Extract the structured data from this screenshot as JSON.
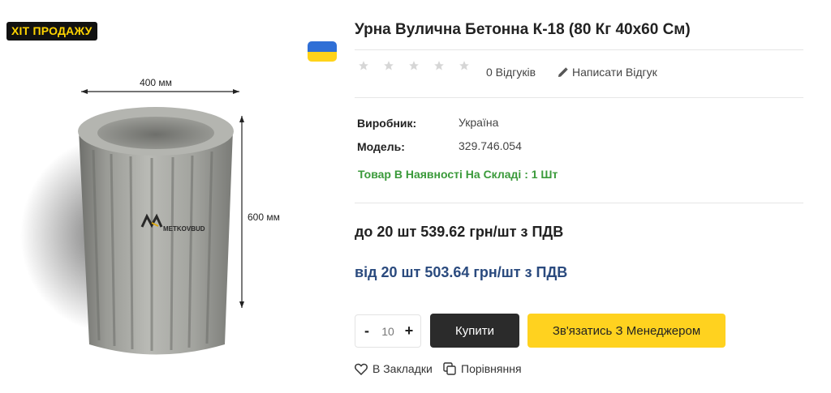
{
  "badge": {
    "label": "ХІТ ПРОДАЖУ"
  },
  "product": {
    "title": "Урна Вулична Бетонна К-18 (80 Кг 40х60 См)",
    "image": {
      "width_label": "400 мм",
      "height_label": "600 мм",
      "watermark": "METKOVBUD"
    },
    "flag_icon": "ukraine-flag-icon"
  },
  "rating": {
    "stars_filled": 0,
    "stars_total": 5,
    "reviews_label": "0 Відгуків",
    "write_review_label": "Написати Відгук",
    "write_review_icon": "pencil-icon"
  },
  "specs": [
    {
      "label": "Виробник:",
      "value": "Україна"
    },
    {
      "label": "Модель:",
      "value": "329.746.054"
    }
  ],
  "stock": {
    "label": "Товар В Наявності На Складі : 1 Шт",
    "color": "#3a9a3a"
  },
  "prices": {
    "tier1": "до 20 шт 539.62 грн/шт з ПДВ",
    "tier2": "від 20 шт 503.64 грн/шт з ПДВ",
    "tier2_color": "#2a4a7e"
  },
  "cart": {
    "minus": "-",
    "quantity": "10",
    "plus": "+",
    "buy_label": "Купити",
    "manager_label": "Зв'язатись З Менеджером",
    "buy_color": "#2b2b2b",
    "manager_color": "#ffd21f"
  },
  "actions": {
    "wishlist_label": "В Закладки",
    "wishlist_icon": "heart-icon",
    "compare_label": "Порівняння",
    "compare_icon": "compare-icon"
  }
}
